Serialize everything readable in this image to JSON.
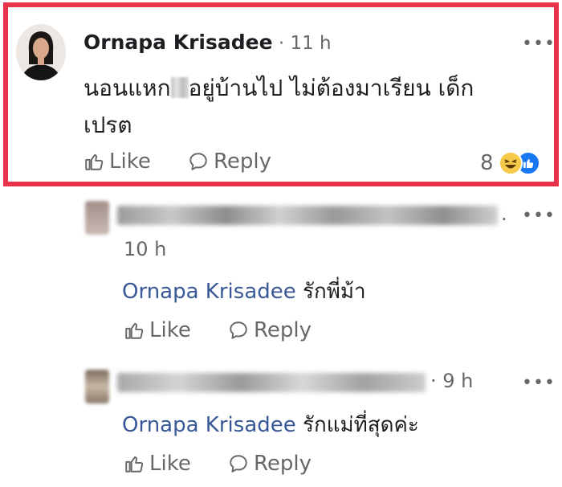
{
  "main_comment": {
    "author": "Ornapa Krisadee",
    "separator": " · ",
    "time": "11 h",
    "text_part1": "นอนแหก",
    "text_part2": "อยู่บ้านไป ไม่ต้องมาเรียน เด็ก",
    "text_part3": "เปรต",
    "like_label": "Like",
    "reply_label": "Reply",
    "reaction_count": "8",
    "more_label": "•••"
  },
  "replies": [
    {
      "time": "10 h",
      "mention": "Ornapa Krisadee",
      "text": "รักพี่ม้า",
      "like_label": "Like",
      "reply_label": "Reply",
      "more_label": "•••",
      "trailing": "."
    },
    {
      "time": "· 9 h",
      "mention": "Ornapa Krisadee",
      "text": "รักแม่ที่สุดค่ะ",
      "like_label": "Like",
      "reply_label": "Reply",
      "more_label": "•••"
    }
  ],
  "colors": {
    "highlight_border": "#e8334a",
    "mention": "#385898",
    "meta": "#65676b",
    "like_blue": "#1877f2",
    "haha_yellow": "#f7c948"
  }
}
